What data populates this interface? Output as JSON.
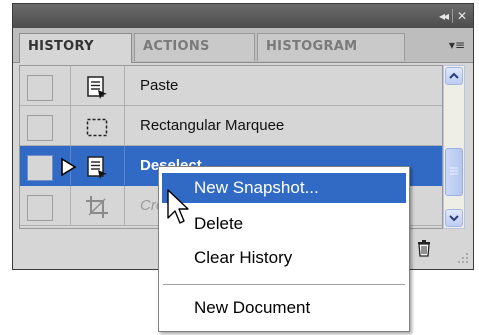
{
  "panel": {
    "titlebar": {
      "collapse_glyph": "◂◂",
      "close_glyph": "✕"
    },
    "tabs": [
      {
        "label": "HISTORY",
        "active": true
      },
      {
        "label": "ACTIONS",
        "active": false
      },
      {
        "label": "HISTOGRAM",
        "active": false
      }
    ],
    "panel_menu_glyph": "▾≡"
  },
  "history": {
    "items": [
      {
        "label": "Paste",
        "icon": "history-state-icon"
      },
      {
        "label": "Rectangular Marquee",
        "icon": "rectangular-marquee-icon"
      },
      {
        "label": "Deselect",
        "icon": "history-state-icon",
        "selected": true
      },
      {
        "label": "Crop",
        "icon": "crop-icon",
        "dimmed": true
      }
    ]
  },
  "context_menu": {
    "items": [
      {
        "label": "New Snapshot...",
        "highlighted": true
      },
      {
        "label": "Delete"
      },
      {
        "label": "Clear History"
      },
      {
        "label": "New Document"
      }
    ]
  },
  "colors": {
    "selection": "#316ac5",
    "panel_bg": "#d6d6d6",
    "titlebar": "#555555"
  },
  "icons": [
    "history-state-icon",
    "rectangular-marquee-icon",
    "crop-icon",
    "trash-icon",
    "history-state-pointer-icon",
    "mouse-cursor-icon"
  ]
}
